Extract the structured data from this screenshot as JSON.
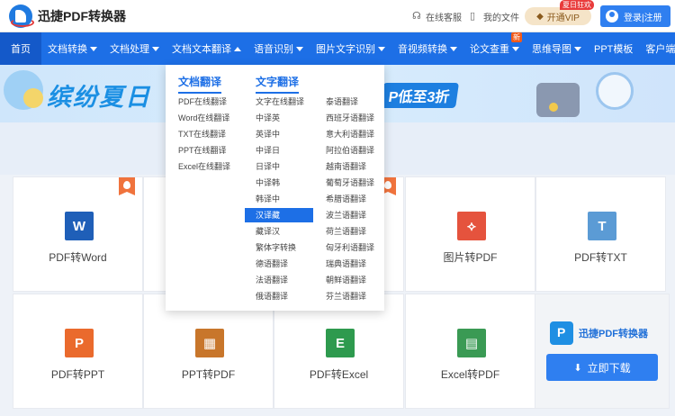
{
  "topbar": {
    "app_name": "迅捷PDF转换器",
    "service_label": "在线客服",
    "files_label": "我的文件",
    "vip_label": "开通VIP",
    "vip_tag": "夏日狂欢",
    "login_label": "登录|注册"
  },
  "nav": {
    "items": [
      {
        "label": "首页"
      },
      {
        "label": "文档转换"
      },
      {
        "label": "文档处理"
      },
      {
        "label": "文档文本翻译"
      },
      {
        "label": "语音识别"
      },
      {
        "label": "图片文字识别"
      },
      {
        "label": "音视频转换"
      },
      {
        "label": "论文查重"
      },
      {
        "label": "思维导图"
      },
      {
        "label": "PPT模板"
      },
      {
        "label": "客户端"
      }
    ],
    "new_badge": "新"
  },
  "banner": {
    "title": "缤纷夏日",
    "promo": "P低至3折"
  },
  "dropdown": {
    "doc_translate_head": "文档翻译",
    "text_translate_head": "文字翻译",
    "doc_items": [
      "PDF在线翻译",
      "Word在线翻译",
      "TXT在线翻译",
      "PPT在线翻译",
      "Excel在线翻译"
    ],
    "text_col1": [
      "文字在线翻译",
      "中译英",
      "英译中",
      "中译日",
      "日译中",
      "中译韩",
      "韩译中",
      "汉译藏",
      "藏译汉",
      "繁体字转换",
      "德语翻译",
      "法语翻译",
      "俄语翻译"
    ],
    "text_col2": [
      "泰语翻译",
      "西班牙语翻译",
      "意大利语翻译",
      "阿拉伯语翻译",
      "越南语翻译",
      "葡萄牙语翻译",
      "希腊语翻译",
      "波兰语翻译",
      "荷兰语翻译",
      "匈牙利语翻译",
      "瑞典语翻译",
      "朝鲜语翻译",
      "芬兰语翻译"
    ],
    "selected": "汉译藏"
  },
  "cards": [
    {
      "label": "PDF转Word",
      "icon": "word-icon",
      "glyph": "W",
      "color": "#1f5fb8"
    },
    {
      "label": "图片转PDF",
      "icon": "image-pdf-icon",
      "glyph": "⟡",
      "color": "#e5533d"
    },
    {
      "label": "PDF转TXT",
      "icon": "txt-icon",
      "glyph": "T",
      "color": "#5b9bd5"
    },
    {
      "label": "PDF转PPT",
      "icon": "ppt-icon",
      "glyph": "P",
      "color": "#ea6a2d"
    },
    {
      "label": "PPT转PDF",
      "icon": "ppt-pdf-icon",
      "glyph": "▦",
      "color": "#c8762b"
    },
    {
      "label": "PDF转Excel",
      "icon": "excel-icon",
      "glyph": "E",
      "color": "#2e9a4e"
    },
    {
      "label": "Excel转PDF",
      "icon": "excel-pdf-icon",
      "glyph": "▤",
      "color": "#3a9a54"
    }
  ],
  "promo": {
    "name": "迅捷PDF转换器",
    "download_label": "立即下载"
  }
}
